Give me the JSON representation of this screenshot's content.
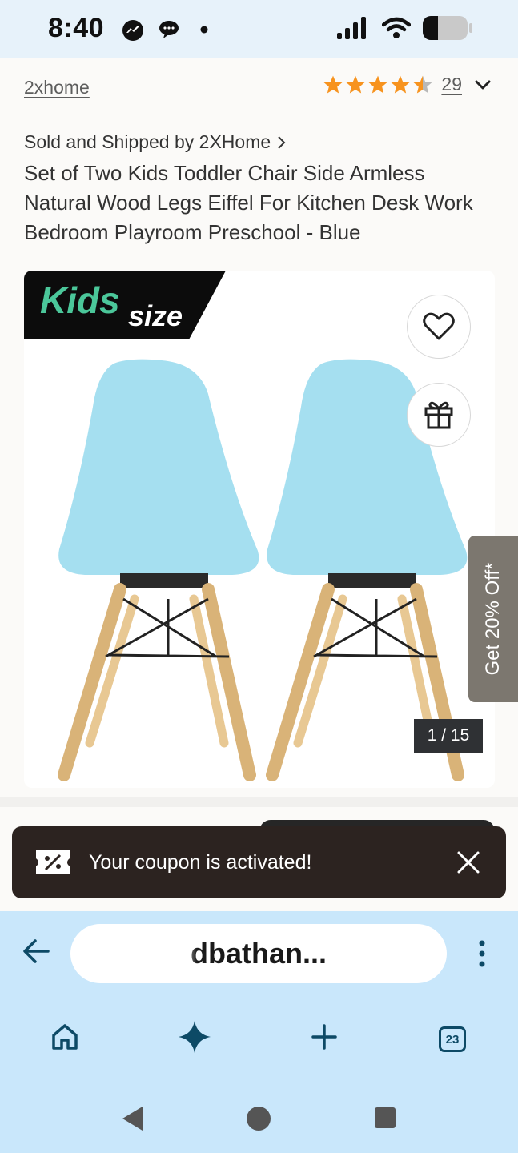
{
  "status_bar": {
    "time": "8:40",
    "left_icons": [
      "messenger-icon",
      "chat-bubble-icon",
      "dot-icon"
    ],
    "right_icons": [
      "signal-icon",
      "wifi-icon",
      "battery-icon"
    ]
  },
  "header": {
    "brand": "2xhome",
    "rating_value": 4.5,
    "review_count": "29"
  },
  "product": {
    "seller": "Sold and Shipped by 2XHome",
    "title": "Set of Two Kids Toddler Chair Side Armless Natural Wood Legs Eiffel For Kitchen Desk Work Bedroom Playroom Preschool - Blue"
  },
  "gallery": {
    "badge_main": "Kids",
    "badge_sub": "size",
    "image_counter": "1 / 15",
    "wishlist_icon": "heart-icon",
    "gift_icon": "gift-icon"
  },
  "promo_tab": {
    "label": "Get 20% Off*"
  },
  "toast": {
    "message": "Your coupon is activated!",
    "icon": "coupon-icon"
  },
  "browser": {
    "url": "dbathan...",
    "tab_count": "23",
    "nav_icons": [
      "home-icon",
      "sparkle-icon",
      "plus-icon",
      "tabs-icon"
    ]
  },
  "colors": {
    "status_bg": "#e7f2fa",
    "browser_bg": "#c9e7fb",
    "star": "#f7931e",
    "toast_bg": "#2c2320",
    "chair_blue": "#a5dff0",
    "icon_dark": "#0d4a66"
  }
}
